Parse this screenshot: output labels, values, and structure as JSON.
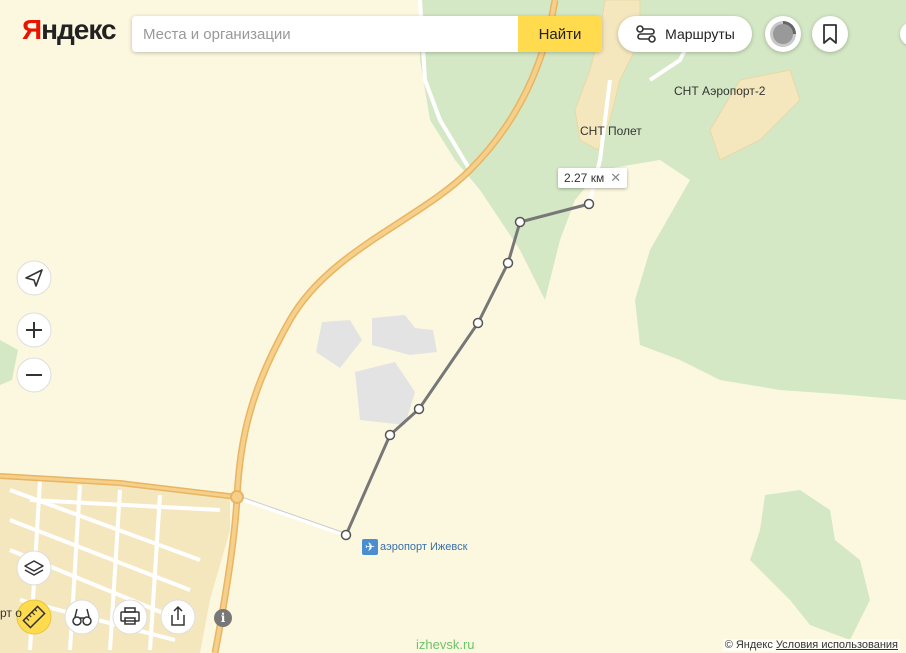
{
  "header": {
    "logo_first": "Я",
    "logo_rest": "ндекс",
    "search_placeholder": "Места и организации",
    "search_value": "",
    "find_label": "Найти",
    "routes_label": "Маршруты"
  },
  "map": {
    "distance_label": "2.27 км",
    "place_labels": {
      "snt_aeroport_2": "СНТ Аэропорт-2",
      "snt_polet": "СНТ Полет",
      "airport": "аэропорт Ижевск",
      "partial_left": "рт  о"
    },
    "colors": {
      "land": "#fcf8e0",
      "forest": "#d4e8c5",
      "road_major": "#f2c069",
      "road_minor": "#ffffff",
      "building": "#e4e4e4",
      "ruler_line": "#777777",
      "airport_icon": "#4a8ed0",
      "accent_button": "#ffdb4d"
    },
    "controls": {
      "locate": "locate-icon",
      "zoom_in": "+",
      "zoom_out": "−",
      "layers": "layers-icon",
      "ruler": "ruler-icon",
      "panorama": "binoculars-icon",
      "print": "print-icon",
      "share": "share-icon"
    }
  },
  "footer": {
    "copyright": "© Яндекс",
    "terms": "Условия использования",
    "watermark": "izhevsk.ru"
  }
}
